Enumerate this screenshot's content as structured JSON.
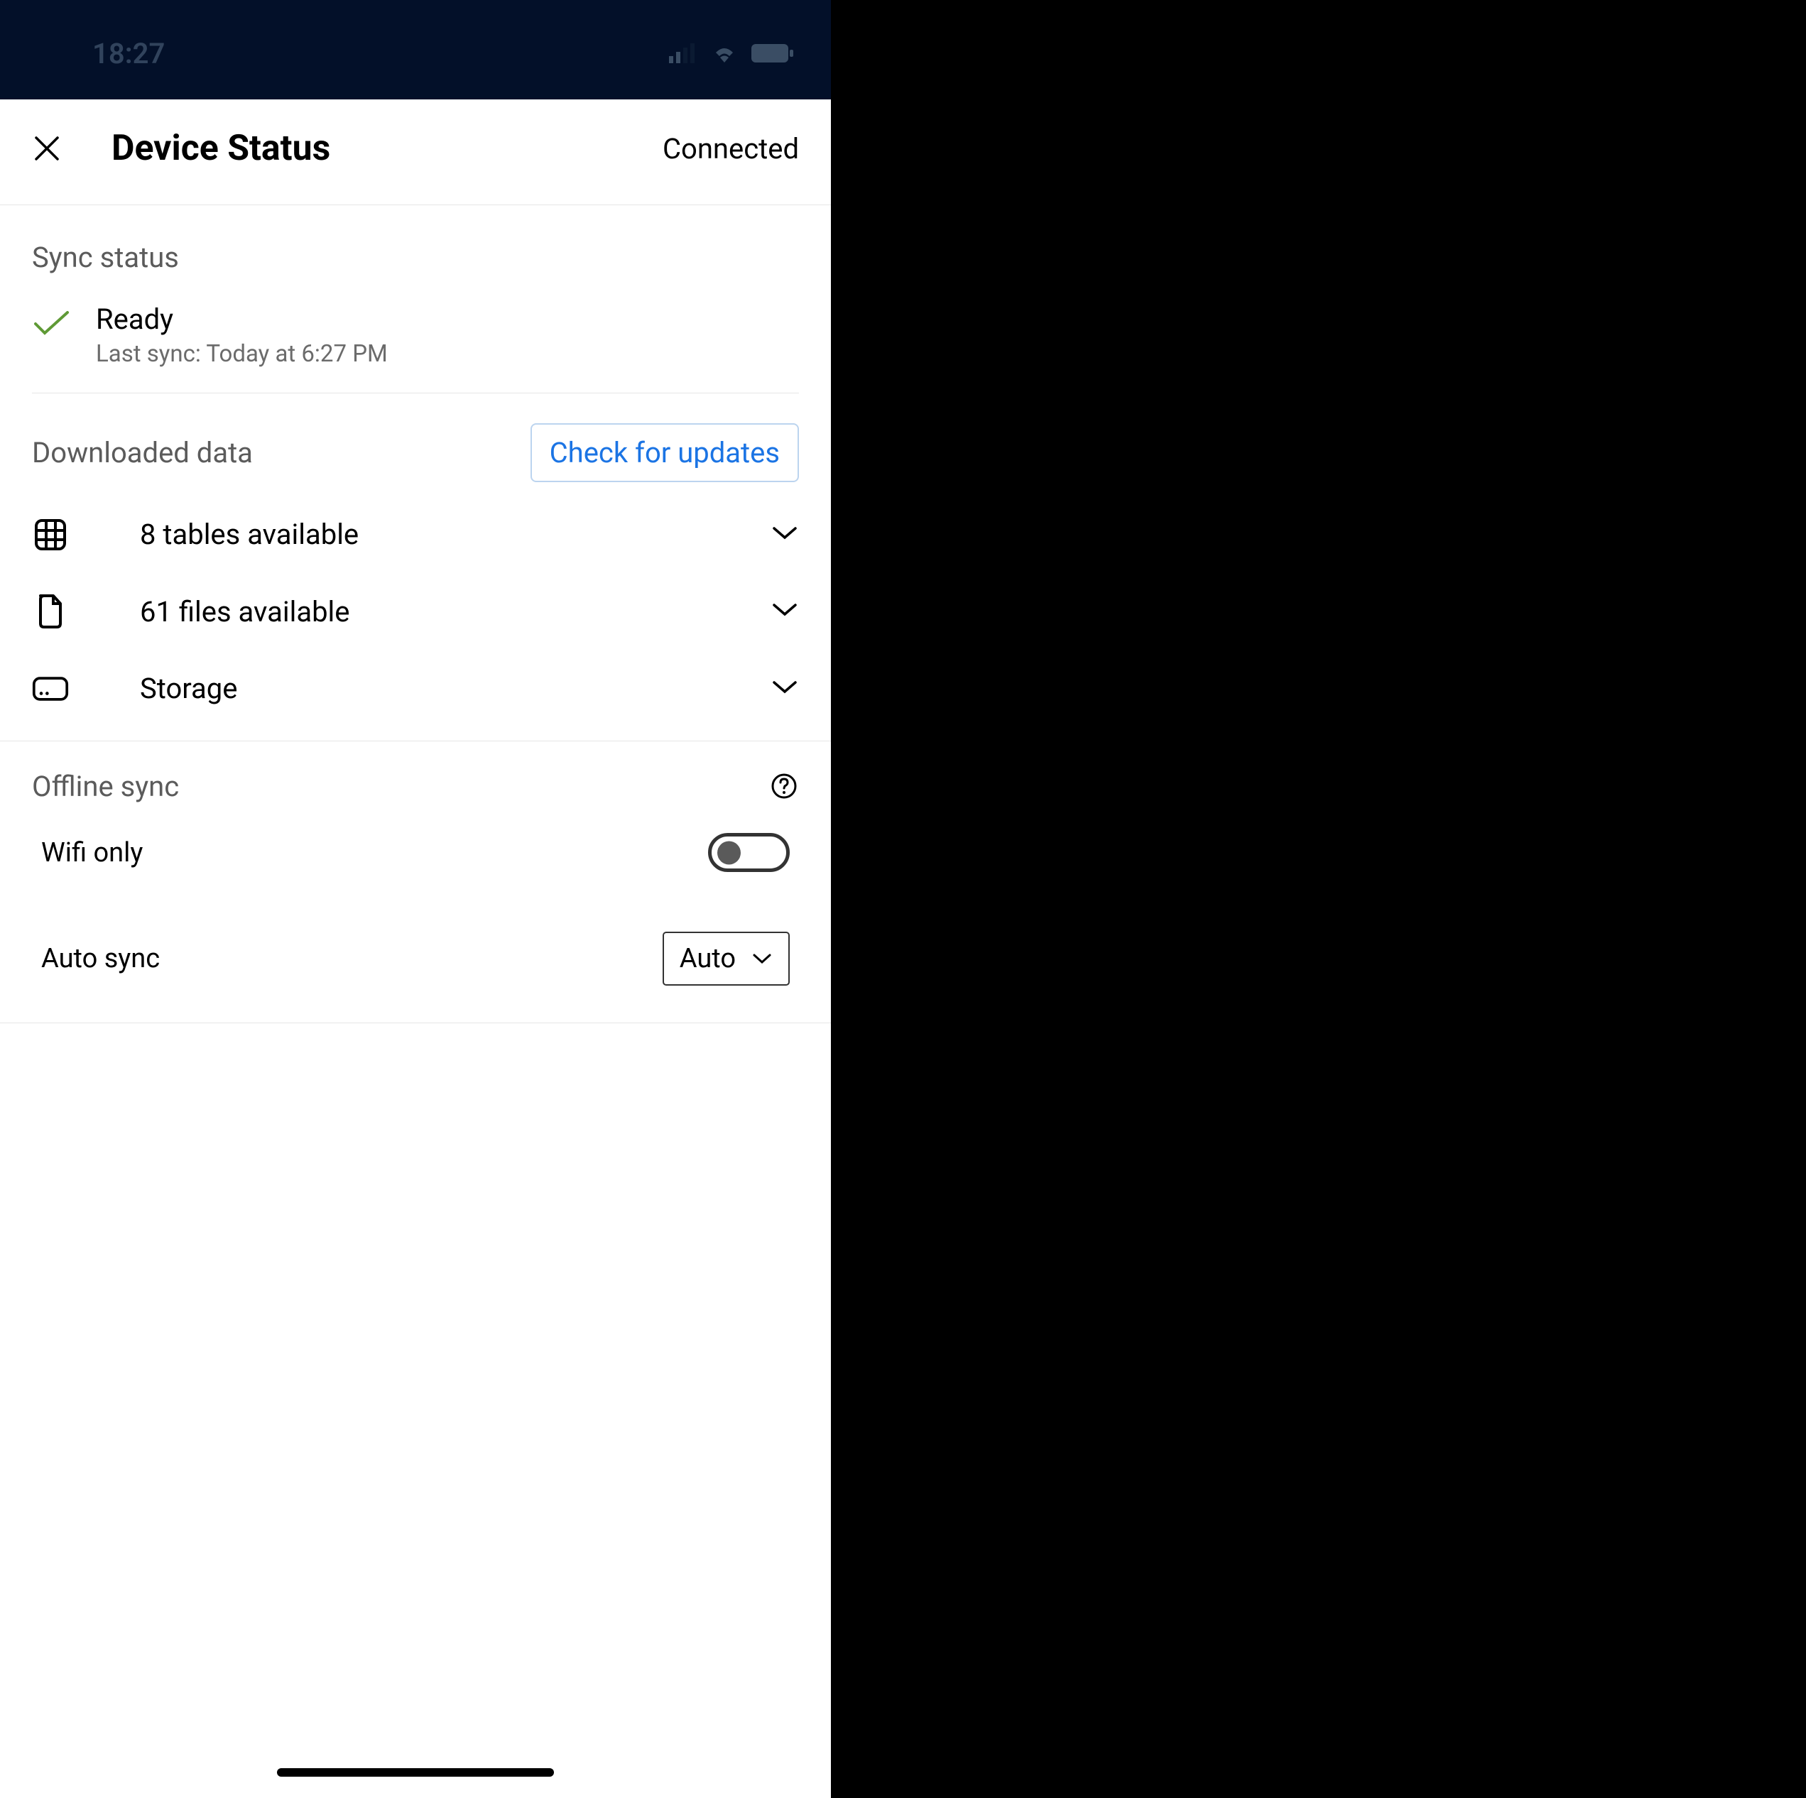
{
  "status_bar": {
    "time": "18:27"
  },
  "header": {
    "title": "Device Status",
    "status": "Connected"
  },
  "sync_status": {
    "section_label": "Sync status",
    "state": "Ready",
    "last_sync": "Last sync: Today at 6:27 PM"
  },
  "downloaded_data": {
    "section_label": "Downloaded data",
    "check_updates_label": "Check for updates",
    "rows": [
      {
        "label": "8 tables available"
      },
      {
        "label": "61 files available"
      },
      {
        "label": "Storage"
      }
    ]
  },
  "offline_sync": {
    "section_label": "Offline sync",
    "wifi_only_label": "Wifi only",
    "auto_sync_label": "Auto sync",
    "auto_sync_value": "Auto"
  }
}
